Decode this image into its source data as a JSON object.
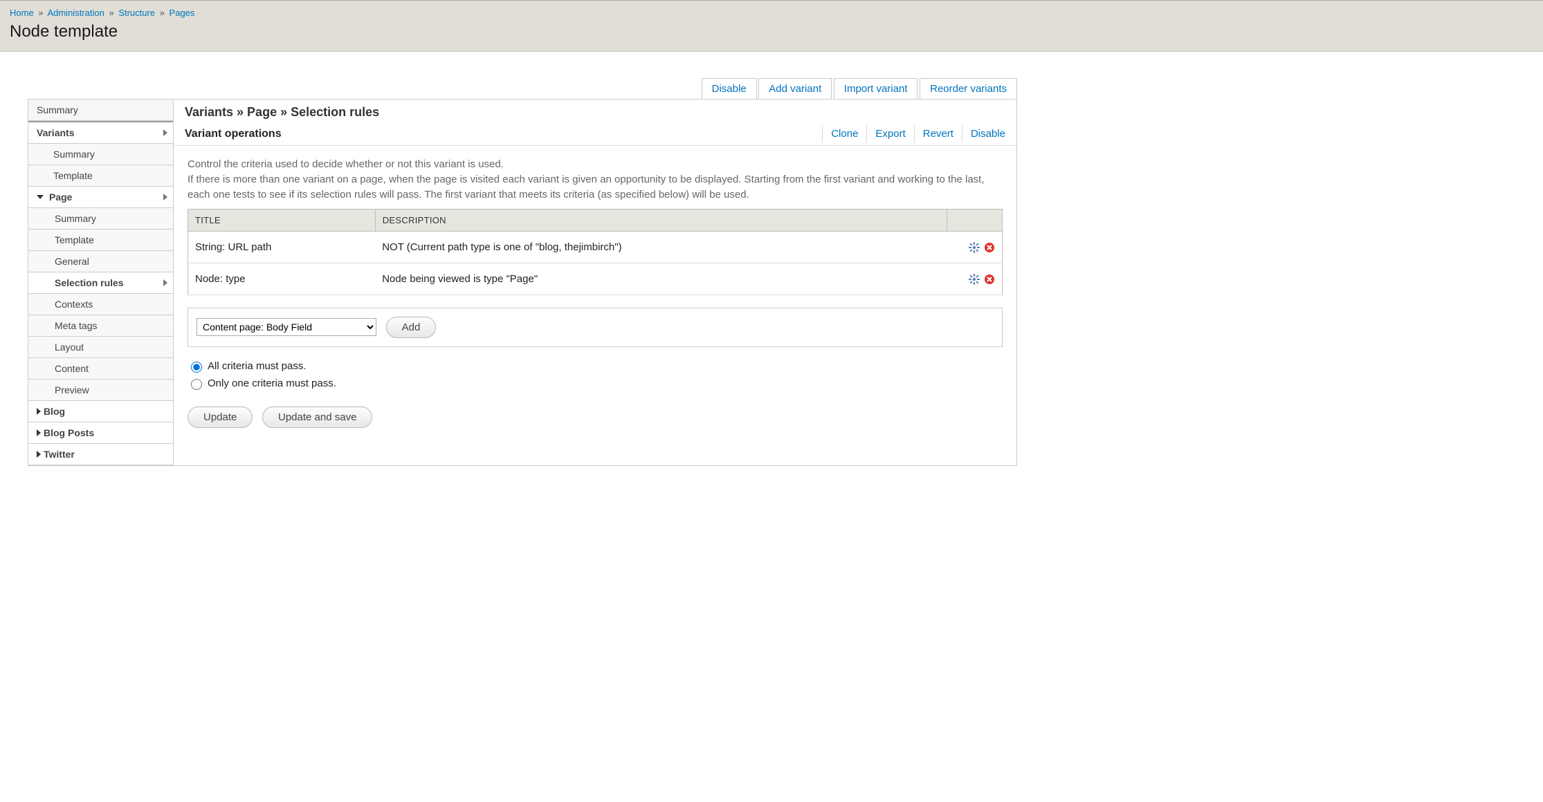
{
  "breadcrumb": {
    "items": [
      "Home",
      "Administration",
      "Structure",
      "Pages"
    ],
    "sep": "»"
  },
  "page_title": "Node template",
  "main_tabs": {
    "disable": "Disable",
    "add_variant": "Add variant",
    "import_variant": "Import variant",
    "reorder_variants": "Reorder variants"
  },
  "sidebar": {
    "summary": "Summary",
    "variants": "Variants",
    "sub_summary": "Summary",
    "sub_template": "Template",
    "page": "Page",
    "page_summary": "Summary",
    "page_template": "Template",
    "page_general": "General",
    "page_selection_rules": "Selection rules",
    "page_contexts": "Contexts",
    "page_meta_tags": "Meta tags",
    "page_layout": "Layout",
    "page_content": "Content",
    "page_preview": "Preview",
    "blog": "Blog",
    "blog_posts": "Blog Posts",
    "twitter": "Twitter"
  },
  "content": {
    "breadcrumb": "Variants » Page » Selection rules",
    "variant_ops_title": "Variant operations",
    "ops": {
      "clone": "Clone",
      "export": "Export",
      "revert": "Revert",
      "disable": "Disable"
    },
    "description_1": "Control the criteria used to decide whether or not this variant is used.",
    "description_2": "If there is more than one variant on a page, when the page is visited each variant is given an opportunity to be displayed. Starting from the first variant and working to the last, each one tests to see if its selection rules will pass. The first variant that meets its criteria (as specified below) will be used.",
    "table": {
      "col_title": "TITLE",
      "col_desc": "DESCRIPTION",
      "rows": [
        {
          "title": "String: URL path",
          "desc": "NOT (Current path type is one of \"blog, thejimbirch\")"
        },
        {
          "title": "Node: type",
          "desc": "Node being viewed is type \"Page\""
        }
      ]
    },
    "add": {
      "selected": "Content page: Body Field",
      "button": "Add"
    },
    "radios": {
      "all": "All criteria must pass.",
      "one": "Only one criteria must pass."
    },
    "actions": {
      "update": "Update",
      "update_save": "Update and save"
    }
  }
}
